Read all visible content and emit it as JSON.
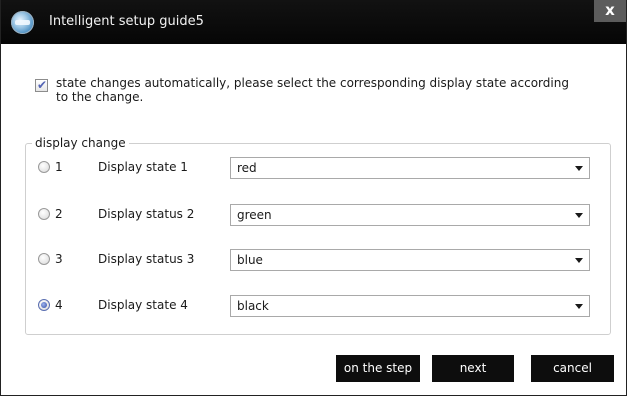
{
  "window": {
    "title": "Intelligent setup guide5",
    "close_label": "x",
    "app_icon": "app-globe-icon"
  },
  "auto_state": {
    "checked": true,
    "check_glyph": "✔",
    "text": "state changes automatically, please select the corresponding display state according to the change."
  },
  "group": {
    "legend": "display change",
    "rows": [
      {
        "number": "1",
        "label": "Display state 1",
        "value": "red",
        "selected": false
      },
      {
        "number": "2",
        "label": "Display status 2",
        "value": "green",
        "selected": false
      },
      {
        "number": "3",
        "label": "Display status 3",
        "value": "blue",
        "selected": false
      },
      {
        "number": "4",
        "label": "Display state 4",
        "value": "black",
        "selected": true
      }
    ]
  },
  "buttons": {
    "prev_label": "on the step",
    "next_label": "next",
    "cancel_label": "cancel"
  },
  "colors": {
    "titlebar": "#0b0b0b",
    "button": "#0d0d0d",
    "radio_selected": "#2f4aa3"
  }
}
